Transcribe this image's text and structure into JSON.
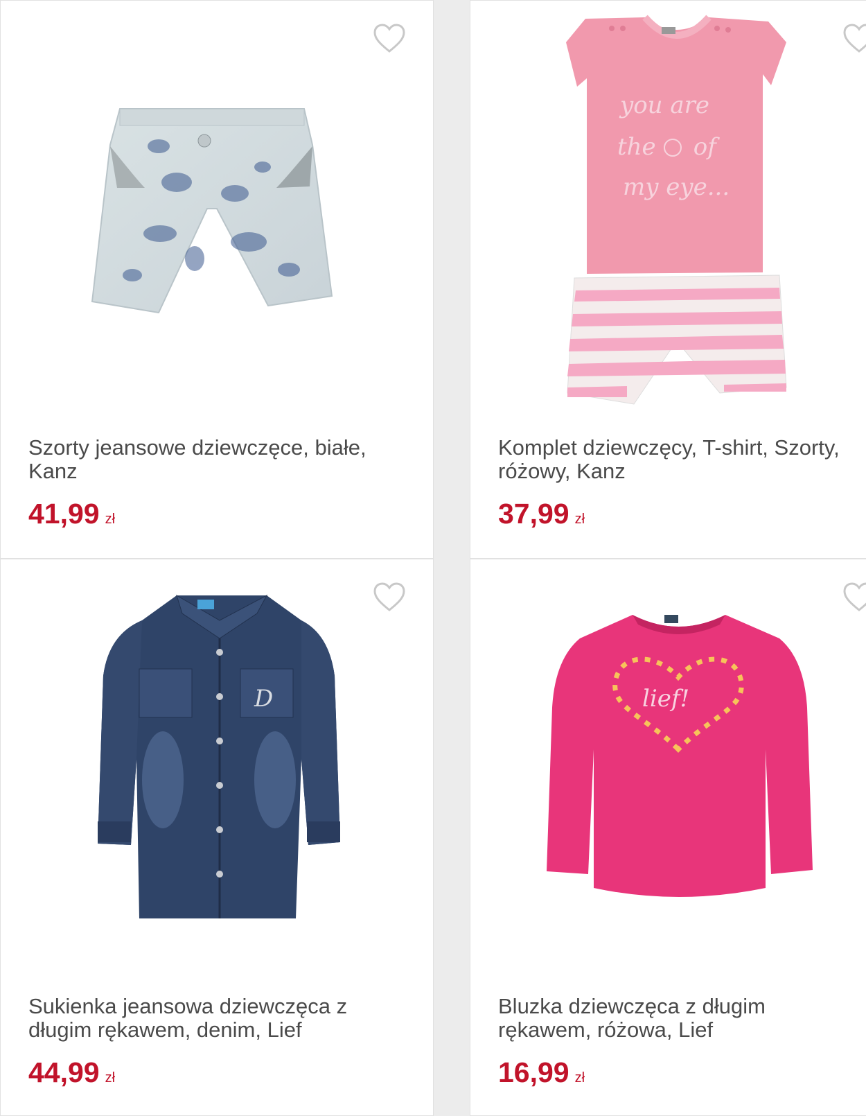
{
  "colors": {
    "price": "#c1132a",
    "title": "#4a4a4a",
    "background": "#ececec",
    "card": "#ffffff",
    "heart_outline": "#c8c8c8"
  },
  "icons": {
    "wishlist": "heart-outline-icon"
  },
  "products": [
    {
      "title_line1": "Szorty jeansowe dziewczęce, białe,",
      "title_line2": "Kanz",
      "price": "41,99",
      "currency": "zł",
      "image": "light-tie-dye-denim-shorts"
    },
    {
      "title_line1": "Komplet dziewczęcy, T-shirt, Szorty,",
      "title_line2": "różowy, Kanz",
      "price": "37,99",
      "currency": "zł",
      "image": "pink-tshirt-and-striped-shorts-set",
      "tshirt_print": [
        "you are",
        "the     of",
        "my eye..."
      ]
    },
    {
      "title_line1": "Sukienka jeansowa dziewczęca z",
      "title_line2": "długim rękawem, denim, Lief",
      "price": "44,99",
      "currency": "zł",
      "image": "dark-denim-long-sleeve-dress"
    },
    {
      "title_line1": "Bluzka dziewczęca z długim",
      "title_line2": "rękawem, różowa, Lief",
      "price": "16,99",
      "currency": "zł",
      "image": "pink-long-sleeve-top-heart-print",
      "print_text": "lief!"
    }
  ]
}
